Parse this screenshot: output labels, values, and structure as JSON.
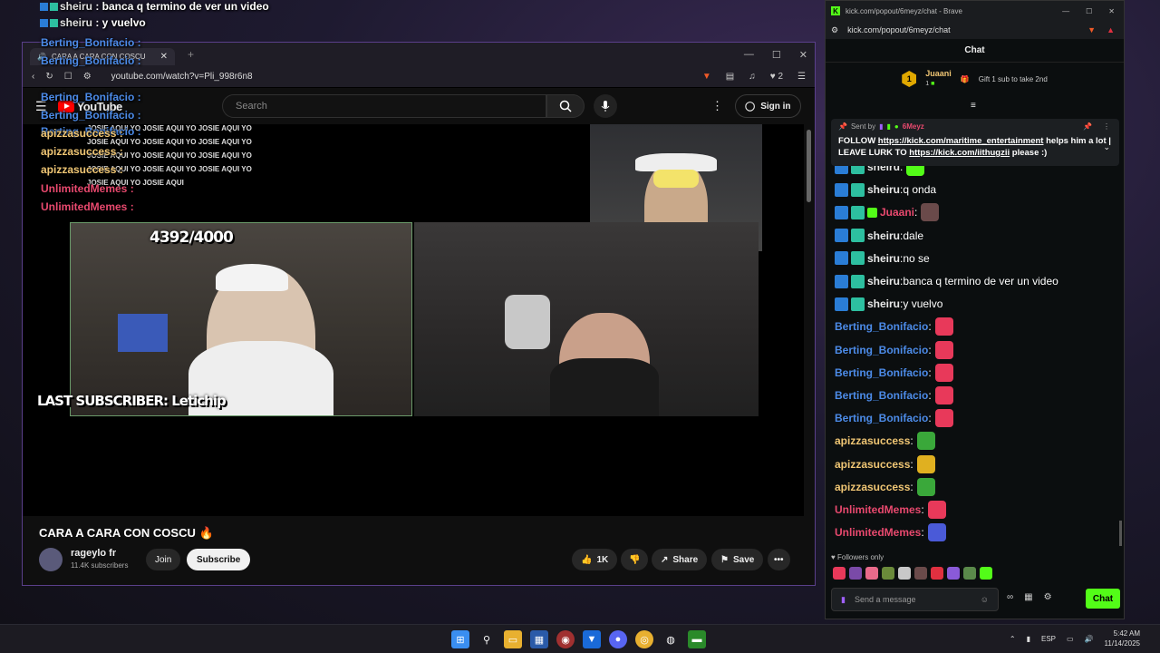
{
  "overlay": {
    "lines": [
      {
        "user": "sheiru",
        "text": " : banca q termino de ver un video",
        "color": "#e0e0e0"
      },
      {
        "user": "sheiru",
        "text": " : y vuelvo",
        "color": "#e0e0e0"
      },
      {
        "user": "Berting_Bonifacio",
        "text": " :",
        "color": "#4c8be8"
      },
      {
        "user": "Berting_Bonifacio",
        "text": " :",
        "color": "#4c8be8"
      },
      {
        "user": "Berting_Bonifacio",
        "text": " :",
        "color": "#4c8be8"
      },
      {
        "user": "Berting_Bonifacio",
        "text": " :",
        "color": "#4c8be8"
      },
      {
        "user": "Berting_Bonifacio",
        "text": " :",
        "color": "#4c8be8"
      },
      {
        "user": "apizzasuccess",
        "text": " :",
        "color": "#f0c674"
      },
      {
        "user": "apizzasuccess",
        "text": " :",
        "color": "#f0c674"
      },
      {
        "user": "apizzasuccess",
        "text": " :",
        "color": "#f0c674"
      },
      {
        "user": "UnlimitedMemes",
        "text": " :",
        "color": "#e8496e"
      },
      {
        "user": "UnlimitedMemes",
        "text": " :",
        "color": "#e8496e"
      }
    ],
    "emote_text": "JOSIE AQUI YO JOSIE AQUI YO JOSIE AQUI YO JOSIE AQUI YO JOSIE AQUI YO JOSIE AQUI YO JOSIE AQUI YO JOSIE AQUI YO JOSIE AQUI YO JOSIE AQUI YO JOSIE AQUI YO JOSIE AQUI YO JOSIE AQUI YO JOSIE AQUI"
  },
  "youtube": {
    "tab_title": "CARA A CARA CON COSCU",
    "url": "youtube.com/watch?v=Pli_998r6n8",
    "extension_count": "2",
    "logo_text": "YouTube",
    "search_placeholder": "Search",
    "sign_in": "Sign in",
    "counter": "4392/4000",
    "last_subscriber": "LAST SUBSCRIBER: Letichip",
    "video_title": "CARA A CARA CON COSCU",
    "channel_name": "rageylo fr",
    "subscribers": "11.4K subscribers",
    "join": "Join",
    "subscribe": "Subscribe",
    "likes": "1K",
    "share": "Share",
    "save": "Save"
  },
  "kick": {
    "window_title": "kick.com/popout/6meyz/chat - Brave",
    "url": "kick.com/popout/6meyz/chat",
    "header": "Chat",
    "top_gifter": "Juaani",
    "top_gifter_count": "1",
    "gift_text": "Gift 1 sub to take 2nd",
    "pinned": {
      "sent_by_label": "Sent by",
      "sent_by_user": "6Meyz",
      "msg_prefix": "FOLLOW ",
      "link1": "https://kick.com/maritime_entertainment",
      "msg_mid": " helps him a lot | LEAVE LURK TO ",
      "link2": "https://kick.com/iithugzii",
      "msg_suffix": " please :)"
    },
    "messages": [
      {
        "user": "sheiru",
        "text": "",
        "color": "#e8e8e8",
        "emote": "#53fc18"
      },
      {
        "user": "sheiru",
        "text": " q onda",
        "color": "#e8e8e8"
      },
      {
        "user": "Juaani",
        "text": "",
        "color": "#e8496e",
        "emote": "#6a4a4a"
      },
      {
        "user": "sheiru",
        "text": " dale",
        "color": "#e8e8e8"
      },
      {
        "user": "sheiru",
        "text": " no se",
        "color": "#e8e8e8"
      },
      {
        "user": "sheiru",
        "text": " banca q termino de ver un video",
        "color": "#e8e8e8"
      },
      {
        "user": "sheiru",
        "text": " y vuelvo",
        "color": "#e8e8e8"
      },
      {
        "user": "Berting_Bonifacio",
        "text": "",
        "color": "#4c8be8",
        "emote": "#e8395a"
      },
      {
        "user": "Berting_Bonifacio",
        "text": "",
        "color": "#4c8be8",
        "emote": "#e8395a"
      },
      {
        "user": "Berting_Bonifacio",
        "text": "",
        "color": "#4c8be8",
        "emote": "#e8395a"
      },
      {
        "user": "Berting_Bonifacio",
        "text": "",
        "color": "#4c8be8",
        "emote": "#e8395a"
      },
      {
        "user": "Berting_Bonifacio",
        "text": "",
        "color": "#4c8be8",
        "emote": "#e8395a"
      },
      {
        "user": "apizzasuccess",
        "text": "",
        "color": "#f0c674",
        "emote": "#3aa83a"
      },
      {
        "user": "apizzasuccess",
        "text": "",
        "color": "#f0c674",
        "emote": "#e0b020"
      },
      {
        "user": "apizzasuccess",
        "text": "",
        "color": "#f0c674",
        "emote": "#3aa83a"
      },
      {
        "user": "UnlimitedMemes",
        "text": "",
        "color": "#e8496e",
        "emote": "#e8395a"
      },
      {
        "user": "UnlimitedMemes",
        "text": "",
        "color": "#e8496e",
        "emote": "#4a5ad8"
      }
    ],
    "followers_only": "Followers only",
    "send_placeholder": "Send a message",
    "chat_button": "Chat"
  },
  "taskbar": {
    "lang": "ESP",
    "time": "5:42 AM",
    "date": "11/14/2025"
  }
}
